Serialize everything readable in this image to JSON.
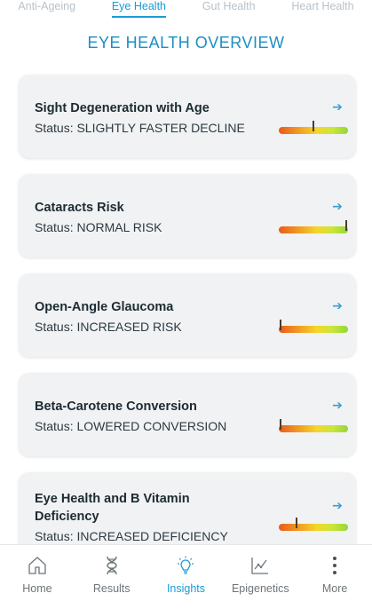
{
  "tabs": [
    {
      "label": "Anti-Ageing"
    },
    {
      "label": "Eye Health",
      "active": true
    },
    {
      "label": "Gut Health"
    },
    {
      "label": "Heart Health"
    }
  ],
  "page_title": "EYE HEALTH OVERVIEW",
  "cards": [
    {
      "title": "Sight Degeneration with Age",
      "status": "Status: SLIGHTLY FASTER DECLINE",
      "level": 0.5
    },
    {
      "title": "Cataracts Risk",
      "status": "Status: NORMAL RISK",
      "level": 0.97
    },
    {
      "title": "Open-Angle Glaucoma",
      "status": "Status: INCREASED RISK",
      "level": 0.03
    },
    {
      "title": "Beta-Carotene Conversion",
      "status": "Status: LOWERED CONVERSION",
      "level": 0.03
    },
    {
      "title": "Eye Health and B Vitamin Deficiency",
      "status": "Status: INCREASED DEFICIENCY",
      "level": 0.26
    }
  ],
  "nav": [
    {
      "label": "Home",
      "icon": "home-icon"
    },
    {
      "label": "Results",
      "icon": "dna-icon"
    },
    {
      "label": "Insights",
      "icon": "lightbulb-icon",
      "active": true
    },
    {
      "label": "Epigenetics",
      "icon": "line-chart-icon"
    },
    {
      "label": "More",
      "icon": "more-vertical-icon"
    }
  ],
  "colors": {
    "accent": "#1a9bd5",
    "title": "#1b8ec4",
    "card_bg": "#f1f2f3",
    "bar_low": "#e85a1d",
    "bar_mid": "#f4d72b",
    "bar_high": "#93d63b"
  }
}
